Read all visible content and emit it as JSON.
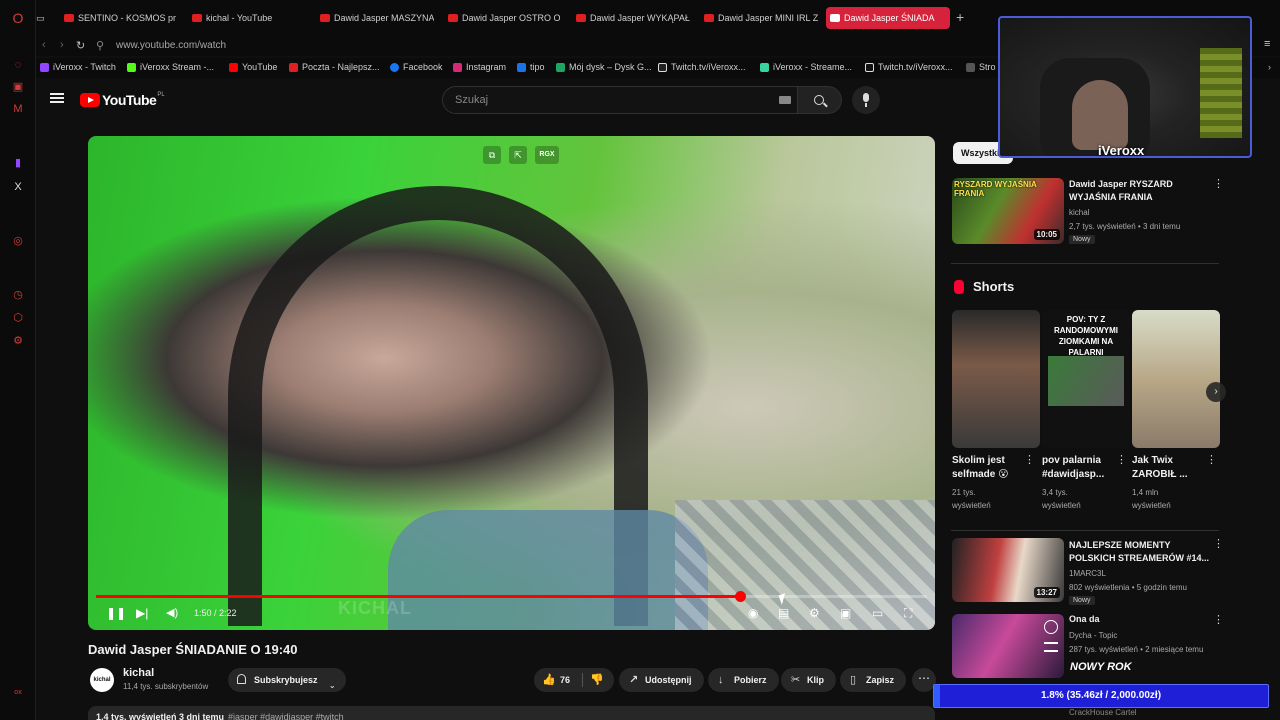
{
  "opera_sidebar": {
    "icons": [
      "opera-logo-icon",
      "messenger-icon",
      "news-icon",
      "twitch-icon",
      "x-icon",
      "player-icon",
      "history-icon",
      "extensions-icon",
      "settings-icon"
    ]
  },
  "tabs": [
    {
      "label": "SENTINO - KOSMOS proc",
      "active": false
    },
    {
      "label": "kichal - YouTube",
      "active": false
    },
    {
      "label": "Dawid Jasper MASZYNA",
      "active": false
    },
    {
      "label": "Dawid Jasper OSTRO O K",
      "active": false
    },
    {
      "label": "Dawid Jasper WYKĄPAŁI",
      "active": false
    },
    {
      "label": "Dawid Jasper MINI IRL Z",
      "active": false
    },
    {
      "label": "Dawid Jasper ŚNIADA",
      "active": true
    }
  ],
  "address": {
    "url": "www.youtube.com/watch"
  },
  "bookmarks": [
    {
      "label": "iVeroxx - Twitch",
      "color": "#9146ff"
    },
    {
      "label": "iVeroxx Stream -...",
      "color": "#53fc18"
    },
    {
      "label": "YouTube",
      "color": "#ff0000"
    },
    {
      "label": "Poczta - Najlepsz...",
      "color": "#e02020"
    },
    {
      "label": "Facebook",
      "color": "#1877f2"
    },
    {
      "label": "Instagram",
      "color": "#d62976"
    },
    {
      "label": "tipo",
      "color": "#1a73e8"
    },
    {
      "label": "Mój dysk – Dysk G...",
      "color": "#1fa463"
    },
    {
      "label": "Twitch.tv/iVeroxx...",
      "color": "#ffffff"
    },
    {
      "label": "iVeroxx - Streame...",
      "color": "#3ad2a0"
    },
    {
      "label": "Twitch.tv/iVeroxx...",
      "color": "#ffffff"
    },
    {
      "label": "Stro",
      "color": "#555555"
    }
  ],
  "youtube": {
    "logo_text": "YouTube",
    "logo_country": "PL",
    "search_placeholder": "Szukaj"
  },
  "player": {
    "time": "1:50 / 2:22",
    "progress": 0.775,
    "overlay_badge": "RGX",
    "watermark": "KICHAL"
  },
  "video": {
    "title": "Dawid Jasper ŚNIADANIE O 19:40",
    "channel": "kichal",
    "channel_avatar": "kichal",
    "subscribers": "11,4 tys. subskrybentów",
    "subscribe_label": "Subskrybujesz",
    "likes": "76",
    "share": "Udostępnij",
    "download": "Pobierz",
    "clip": "Klip",
    "save": "Zapisz",
    "description_stats": "1,4 tys. wyświetleń  3 dni temu",
    "description_tags": "#jasper #dawidjasper #twitch"
  },
  "sidebar": {
    "chip": "Wszystkie",
    "first": {
      "title_l1": "Dawid Jasper RYSZARD",
      "title_l2": "WYJAŚNIA FRANIA",
      "channel": "kichal",
      "meta": "2,7 tys. wyświetleń • 3 dni temu",
      "badge": "Nowy",
      "duration": "10:05",
      "thumb_caption": "RYSZARD WYJAŚNIA FRANIA"
    },
    "shorts_header": "Shorts",
    "shorts": [
      {
        "title_l1": "Skolim jest",
        "title_l2": "selfmade 😮",
        "views_l1": "21 tys.",
        "views_l2": "wyświetleń"
      },
      {
        "title_l1": "pov palarnia",
        "title_l2": "#dawidjasp...",
        "views_l1": "3,4 tys.",
        "views_l2": "wyświetleń",
        "thumb_text": "POV: TY Z RANDOMOWYMI ZIOMKAMI NA PALARNI"
      },
      {
        "title_l1": "Jak Twix",
        "title_l2": "ZAROBIŁ ...",
        "views_l1": "1,4 mln",
        "views_l2": "wyświetleń"
      }
    ],
    "rec2": {
      "title_l1": "NAJLEPSZE MOMENTY",
      "title_l2": "POLSKICH STREAMERÓW #14...",
      "channel": "1MARC3L",
      "meta": "802 wyświetlenia • 5 godzin temu",
      "badge": "Nowy",
      "duration": "13:27"
    },
    "rec3": {
      "title": "Ona da",
      "channel": "Dycha - Topic",
      "meta": "287 tys. wyświetleń • 2 miesiące temu"
    },
    "rec4_channel": "CrackHouse Cartel"
  },
  "stream_overlay": {
    "streamer_name": "iVeroxx",
    "goal_title": "NOWY ROK",
    "goal_text": "1.8% (35.46zł / 2,000.00zł)",
    "goal_fraction": 0.018
  }
}
